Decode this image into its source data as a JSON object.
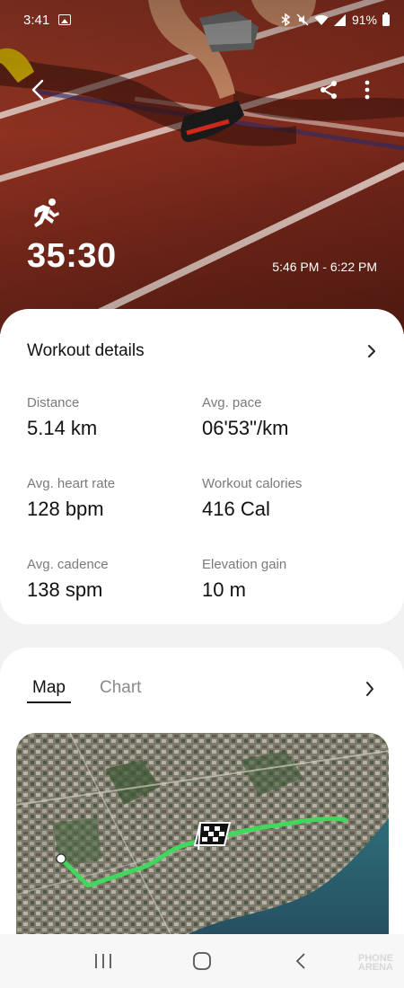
{
  "status_bar": {
    "time": "3:41",
    "battery": "91%",
    "icons": [
      "image-icon",
      "bluetooth-icon",
      "mute-icon",
      "wifi-icon",
      "signal-icon",
      "battery-icon"
    ]
  },
  "header": {
    "activity_icon": "running-icon",
    "duration": "35:30",
    "time_range": "5:46 PM - 6:22 PM"
  },
  "details": {
    "title": "Workout details",
    "stats": [
      {
        "label": "Distance",
        "value": "5.14 km"
      },
      {
        "label": "Avg. pace",
        "value": "06'53\"/km"
      },
      {
        "label": "Avg. heart rate",
        "value": "128 bpm"
      },
      {
        "label": "Workout calories",
        "value": "416 Cal"
      },
      {
        "label": "Avg. cadence",
        "value": "138 spm"
      },
      {
        "label": "Elevation gain",
        "value": "10 m"
      }
    ]
  },
  "map_section": {
    "tabs": [
      {
        "label": "Map",
        "active": true
      },
      {
        "label": "Chart",
        "active": false
      }
    ]
  },
  "watermark": [
    "PHONE",
    "ARENA"
  ],
  "colors": {
    "route": "#3ddc5c",
    "track": "#8a2f1f",
    "card": "#ffffff"
  }
}
